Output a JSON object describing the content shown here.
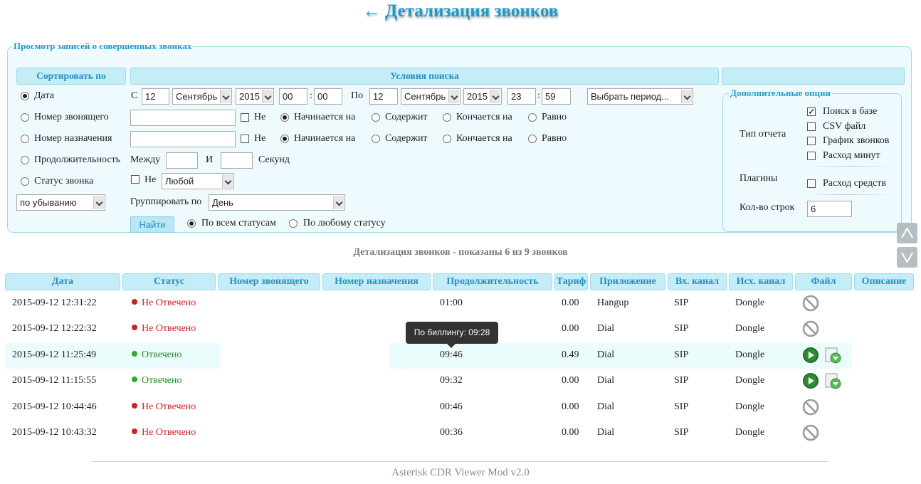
{
  "page": {
    "title_arrow": "←",
    "title": "Детализация звонков"
  },
  "search": {
    "legend": "Просмотр записей о совершенных звонках",
    "col_sort": "Сортировать по",
    "col_conditions": "Условия поиска",
    "sort_options": [
      {
        "label": "Дата",
        "selected": true
      },
      {
        "label": "Номер звонящего",
        "selected": false
      },
      {
        "label": "Номер назначения",
        "selected": false
      },
      {
        "label": "Продолжительность",
        "selected": false
      },
      {
        "label": "Статус звонка",
        "selected": false
      }
    ],
    "order": "по убыванию",
    "date_from_label": "С",
    "date_from": {
      "day": "12",
      "month": "Сентябрь",
      "year": "2015",
      "hour": "00",
      "minute": "00"
    },
    "date_to_label": "По",
    "date_to": {
      "day": "12",
      "month": "Сентябрь",
      "year": "2015",
      "hour": "23",
      "minute": "59"
    },
    "time_sep": ":",
    "period_placeholder": "Выбрать период...",
    "not_label": "Не",
    "match_options": [
      "Начинается на",
      "Содержит",
      "Кончается на",
      "Равно"
    ],
    "match_selected": "Начинается на",
    "caller_value": "",
    "dest_value": "",
    "between_label": "Между",
    "and_label": "И",
    "seconds_label": "Секунд",
    "duration_from": "",
    "duration_to": "",
    "status_value": "Любой",
    "group_by_label": "Группировать по",
    "group_by_value": "День",
    "find_button": "Найти",
    "status_scope": [
      {
        "label": "По всем статусам",
        "selected": true
      },
      {
        "label": "По любому статусу",
        "selected": false
      }
    ]
  },
  "options": {
    "legend": "Дополнительные опции",
    "report_type_label": "Тип отчета",
    "report_types": [
      {
        "label": "Поиск в базе",
        "checked": true
      },
      {
        "label": "CSV файл",
        "checked": false
      },
      {
        "label": "График звонков",
        "checked": false
      },
      {
        "label": "Расход минут",
        "checked": false
      }
    ],
    "plugins_label": "Плагины",
    "plugins": [
      {
        "label": "Расход средств",
        "checked": false
      }
    ],
    "rows_label": "Кол-во строк",
    "rows_value": "6"
  },
  "results": {
    "subtitle": "Детализация звонков - показаны 6 из 9 звонков",
    "columns": [
      "Дата",
      "Статус",
      "Номер звонящего",
      "Номер назначения",
      "Продолжительность",
      "Тариф",
      "Приложение",
      "Вх. канал",
      "Исх. канал",
      "Файл",
      "Описание"
    ],
    "rows": [
      {
        "date": "2015-09-12 12:31:22",
        "status": "Не Отвечено",
        "status_type": "missed",
        "caller": "",
        "dest": "",
        "duration": "01:00",
        "tariff": "0.00",
        "app": "Hangup",
        "in_channel": "SIP",
        "out_channel": "Dongle",
        "file": "none",
        "description": ""
      },
      {
        "date": "2015-09-12 12:22:32",
        "status": "Не Отвечено",
        "status_type": "missed",
        "caller": "",
        "dest": "",
        "duration": "",
        "tariff": "0.00",
        "app": "Dial",
        "in_channel": "SIP",
        "out_channel": "Dongle",
        "file": "none",
        "description": ""
      },
      {
        "date": "2015-09-12 11:25:49",
        "status": "Отвечено",
        "status_type": "answered",
        "caller": "",
        "dest": "",
        "duration": "09:46",
        "tariff": "0.49",
        "app": "Dial",
        "in_channel": "SIP",
        "out_channel": "Dongle",
        "file": "audio",
        "description": ""
      },
      {
        "date": "2015-09-12 11:15:55",
        "status": "Отвечено",
        "status_type": "answered",
        "caller": "",
        "dest": "",
        "duration": "09:32",
        "tariff": "0.00",
        "app": "Dial",
        "in_channel": "SIP",
        "out_channel": "Dongle",
        "file": "audio",
        "description": ""
      },
      {
        "date": "2015-09-12 10:44:46",
        "status": "Не Отвечено",
        "status_type": "missed",
        "caller": "",
        "dest": "",
        "duration": "00:46",
        "tariff": "0.00",
        "app": "Dial",
        "in_channel": "SIP",
        "out_channel": "Dongle",
        "file": "none",
        "description": ""
      },
      {
        "date": "2015-09-12 10:43:32",
        "status": "Не Отвечено",
        "status_type": "missed",
        "caller": "",
        "dest": "",
        "duration": "00:36",
        "tariff": "0.00",
        "app": "Dial",
        "in_channel": "SIP",
        "out_channel": "Dongle",
        "file": "none",
        "description": ""
      }
    ],
    "tooltip": "По биллингу: 09:28"
  },
  "colors": {
    "accent": "#1e9ac8",
    "header_bg": "#c5edf8",
    "panel_bg": "#eefafd",
    "missed": "#cc2222",
    "answered": "#2a8a2a"
  },
  "footer": {
    "text": "Asterisk CDR Viewer Mod v2.0"
  }
}
